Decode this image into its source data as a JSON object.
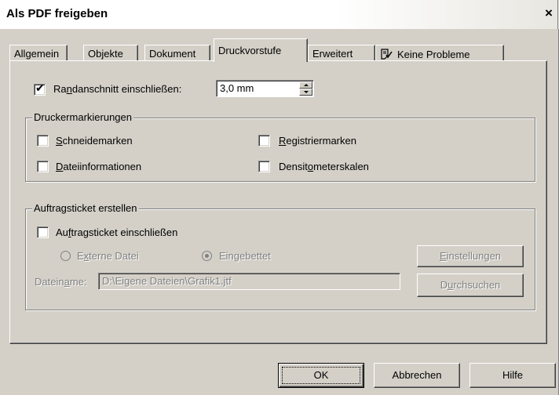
{
  "window": {
    "title": "Als PDF freigeben",
    "close_glyph": "×"
  },
  "tabs": [
    {
      "label": "Allgemein"
    },
    {
      "label": "Objekte"
    },
    {
      "label": "Dokument"
    },
    {
      "label": "Druckvorstufe",
      "active": true
    },
    {
      "label": "Erweitert"
    },
    {
      "label": "Keine Probleme",
      "icon": "document-check-icon"
    }
  ],
  "bleed": {
    "checked": true,
    "label_pre": "Ra",
    "label_u": "n",
    "label_post": "danschnitt einschließen:",
    "value": "3,0 mm"
  },
  "printer_marks": {
    "title": "Druckermarkierungen",
    "items": [
      {
        "u": "S",
        "rest": "chneidemarken",
        "checked": false
      },
      {
        "u": "R",
        "rest": "egistriermarken",
        "checked": false
      },
      {
        "u": "D",
        "rest": "ateiinformationen",
        "checked": false
      },
      {
        "pre": "Densit",
        "u": "o",
        "rest": "meterskalen",
        "checked": false
      }
    ]
  },
  "job_ticket": {
    "title": "Auftragsticket erstellen",
    "include": {
      "pre": "Au",
      "u": "f",
      "rest": "tragsticket einschließen",
      "checked": false
    },
    "radio_external": {
      "pre": "E",
      "u": "x",
      "rest": "terne Datei"
    },
    "radio_embedded": {
      "pre": "Ein",
      "u": "g",
      "rest": "ebettet"
    },
    "filename_label": {
      "pre": "Datein",
      "u": "a",
      "rest": "me:"
    },
    "filename_value": "D:\\Eigene Dateien\\Grafik1.jtf",
    "settings_button": {
      "u": "E",
      "rest": "instellungen"
    },
    "browse_button": {
      "pre": "D",
      "u": "u",
      "rest": "rchsuchen"
    }
  },
  "buttons": {
    "ok": "OK",
    "cancel": "Abbrechen",
    "help": "Hilfe"
  },
  "colors": {
    "face": "#d4d0c8",
    "shadow": "#808080",
    "dark": "#404040",
    "highlight": "#ffffff"
  }
}
